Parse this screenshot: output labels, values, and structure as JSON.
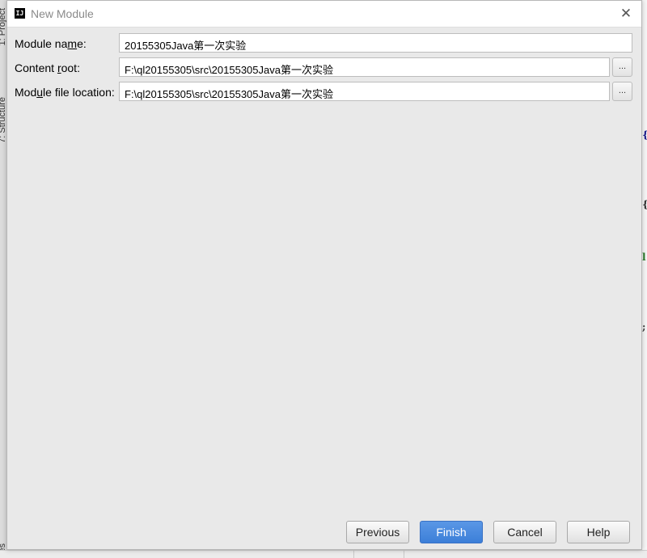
{
  "window": {
    "title": "New Module"
  },
  "ide": {
    "left_tabs": [
      "1: Project",
      "7: Structure"
    ],
    "bottom_tab": "es"
  },
  "form": {
    "module_name": {
      "label_pre": "Module na",
      "label_mnemonic": "m",
      "label_post": "e:",
      "value": "20155305Java第一次实验"
    },
    "content_root": {
      "label_pre": "Content ",
      "label_mnemonic": "r",
      "label_post": "oot:",
      "value": "F:\\ql20155305\\src\\20155305Java第一次实验",
      "browse_label": "..."
    },
    "module_file_location": {
      "label_pre": "Mod",
      "label_mnemonic": "u",
      "label_post": "le file location:",
      "value": "F:\\ql20155305\\src\\20155305Java第一次实验",
      "browse_label": "..."
    }
  },
  "buttons": {
    "previous": "Previous",
    "finish": "Finish",
    "cancel": "Cancel",
    "help": "Help"
  },
  "colors": {
    "primary_button": "#3c7fd8",
    "dialog_bg": "#e9e9e9"
  }
}
